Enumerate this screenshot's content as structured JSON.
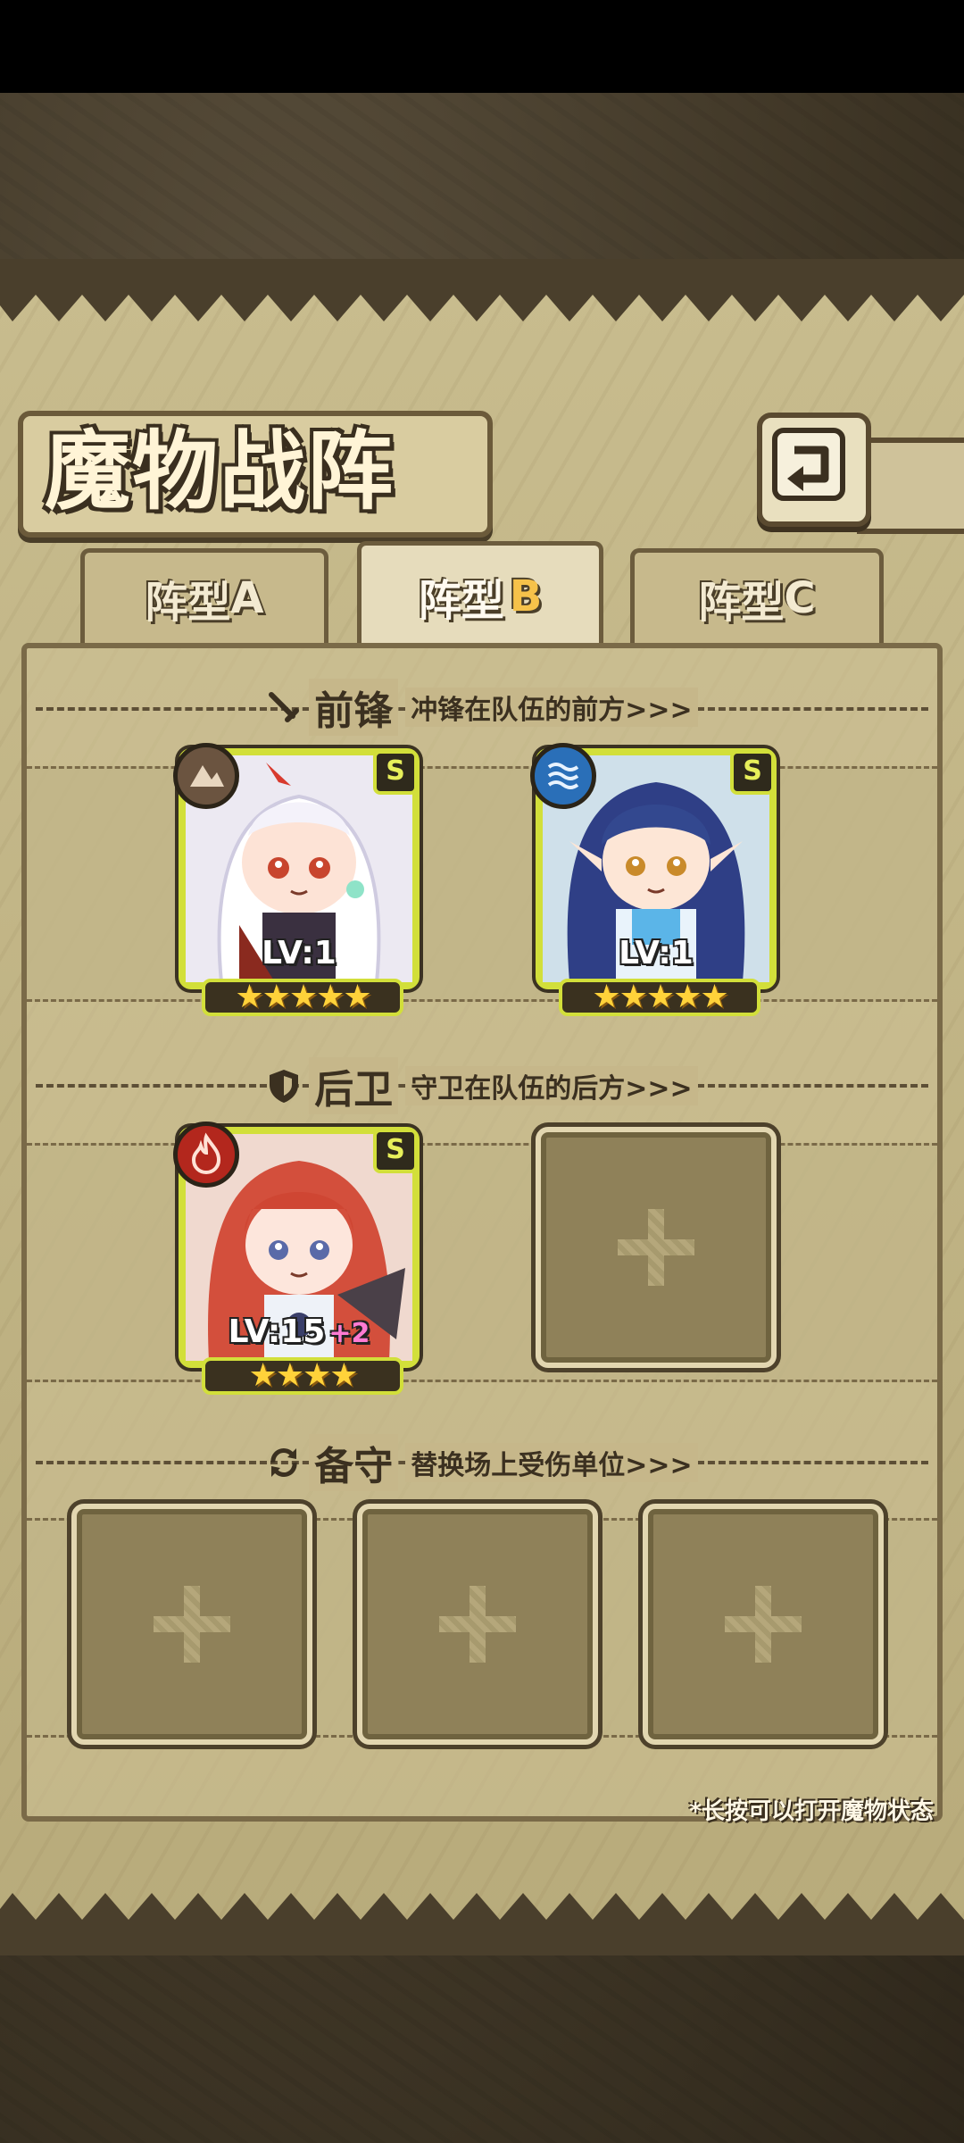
{
  "title": "魔物战阵",
  "tabs": [
    {
      "label": "阵型",
      "suffix": "A",
      "active": false
    },
    {
      "label": "阵型",
      "suffix": "B",
      "active": true
    },
    {
      "label": "阵型",
      "suffix": "C",
      "active": false
    }
  ],
  "sections": {
    "front": {
      "title": "前锋",
      "desc": "冲锋在队伍的前方>>>"
    },
    "rear": {
      "title": "后卫",
      "desc": "守卫在队伍的后方>>>"
    },
    "reserve": {
      "title": "备守",
      "desc": "替换场上受伤单位>>>"
    }
  },
  "units": [
    {
      "rank": "S",
      "level": "LV:1",
      "bonus": "",
      "stars": "★★★★★",
      "element": "earth",
      "color": "#6b5440"
    },
    {
      "rank": "S",
      "level": "LV:1",
      "bonus": "",
      "stars": "★★★★★",
      "element": "water",
      "color": "#2a6fb8"
    },
    {
      "rank": "S",
      "level": "LV:15",
      "bonus": "+2",
      "stars": "★★★★",
      "element": "fire",
      "color": "#b3271d"
    }
  ],
  "footnote": "*长按可以打开魔物状态",
  "icons": {
    "back": "return-arrow-icon",
    "front": "sword-icon",
    "rear": "shield-icon",
    "reserve": "swap-icon",
    "empty": "plus-icon"
  }
}
